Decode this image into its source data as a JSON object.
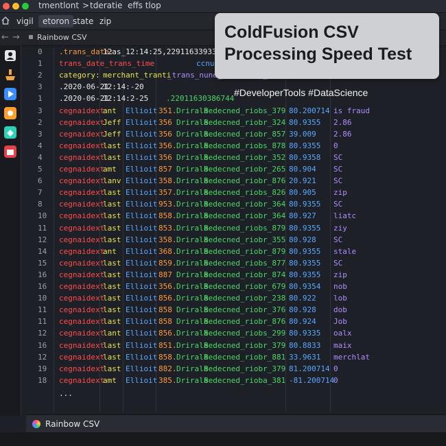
{
  "title_segments": [
    "tmentlont",
    ">",
    "tderatie",
    "effs tlop"
  ],
  "menu": [
    "vigil",
    "etoron",
    "state",
    "zip"
  ],
  "active_menu_index": 1,
  "file_tab": "Rainbow CSV",
  "overlay": {
    "title": "ColdFusion CSV Processing Speed Test",
    "hashtags": "#DeveloperTools #DataScience"
  },
  "colors": {
    "red": "#ff4d4d",
    "orange": "#ff9a3c",
    "yellow": "#e8e24a",
    "green": "#4bd765",
    "blue": "#5aa7ff",
    "purple": "#b18cff",
    "white": "#e8eaee",
    "gray": "#9aa0aa"
  },
  "sidebar_icons": [
    {
      "name": "account-icon",
      "color": "#e6e6e6"
    },
    {
      "name": "debug-icon",
      "color": "#f0a43a"
    },
    {
      "name": "play-icon",
      "color": "#3a8dff"
    },
    {
      "name": "extension-icon",
      "color": "#ff9f2e"
    },
    {
      "name": "tag-icon",
      "color": "#2fd0b8"
    },
    {
      "name": "package-icon",
      "color": "#e2434b"
    }
  ],
  "header_rows": [
    {
      "num": "0",
      "text": ".trans_date:",
      "text2": "12as_12:14:25,22911633933867",
      "color": "orange"
    },
    {
      "num": "1",
      "text": "trans_date_trans_time",
      "text2": "ccnud_Kirlin and Sers_ccnrieu_ ecnl",
      "color": "red"
    },
    {
      "num": "2",
      "text": "category:",
      "text2": "merchant_tranti",
      "text3": "_trans_nune_ merchitt_ rcranations",
      "color": "yellow"
    },
    {
      "num": "3",
      "text": ".2020-06-21",
      "text2": "12:14:-20",
      "color": "white"
    },
    {
      "num": "1",
      "text": ".2020-06-21",
      "text2": "12:14:2-25",
      "text3": ".22011630386744",
      "color": "white"
    }
  ],
  "data_rows": [
    {
      "num": "3",
      "c1": "cegnaidext",
      "c2": "ant",
      "c3": "Ellioit",
      "c4": "351.",
      "c5": "Drirala",
      "c6": "Bedecned_riobs_379",
      "c7": "80.200714",
      "c8": "is fraud"
    },
    {
      "num": "2",
      "c1": "cegnaidext",
      "c2": "Jeff",
      "c3": "Ellioit",
      "c4": "356",
      "c5": "Drirala",
      "c6": "Bedecned_riobr_324",
      "c7": "80.9355",
      "c8": "2.86"
    },
    {
      "num": "3",
      "c1": "cegnaidext",
      "c2": "Jeff",
      "c3": "Ellioit",
      "c4": "356",
      "c5": "Drirala",
      "c6": "Bedecned_riobr_857",
      "c7": "39.009",
      "c8": "2.86"
    },
    {
      "num": "4",
      "c1": "cegnaidext",
      "c2": "last",
      "c3": "Ellioit",
      "c4": "356.",
      "c5": "Drirala",
      "c6": "Bedecned_riobs_878",
      "c7": "80.9355",
      "c8": "0"
    },
    {
      "num": "4",
      "c1": "cegnaidext",
      "c2": "last",
      "c3": "Ellioit",
      "c4": "356",
      "c5": "Drirala",
      "c6": "Bedecned_riobr_352",
      "c7": "80.9358",
      "c8": "SC"
    },
    {
      "num": "5",
      "c1": "cegnaidext",
      "c2": "amt",
      "c3": "Ellioit",
      "c4": "857",
      "c5": "Drirala",
      "c6": "Bedecned_riobr_265",
      "c7": "80.904",
      "c8": "SC"
    },
    {
      "num": "6",
      "c1": "cegnaidext",
      "c2": "lanv",
      "c3": "Ellioit",
      "c4": "358.",
      "c5": "Drirala",
      "c6": "Bedecned_riobr_876",
      "c7": "20.921",
      "c8": "SC"
    },
    {
      "num": "7",
      "c1": "cegnaidext",
      "c2": "last",
      "c3": "Ellioit",
      "c4": "357.",
      "c5": "Drirala",
      "c6": "Bedecned_riobs_826",
      "c7": "80.905",
      "c8": "zip"
    },
    {
      "num": "8",
      "c1": "cegnaidext",
      "c2": "last",
      "c3": "Ellioit",
      "c4": "953.",
      "c5": "Drirala",
      "c6": "Bedecned_riobr_364",
      "c7": "80.9355",
      "c8": "SC"
    },
    {
      "num": "10",
      "c1": "cegnaidext",
      "c2": "last",
      "c3": "Ellioit",
      "c4": "858.",
      "c5": "Drirala",
      "c6": "Bedecned_riobr_364",
      "c7": "80.927",
      "c8": "liatc"
    },
    {
      "num": "11",
      "c1": "cegnaidext",
      "c2": "last",
      "c3": "Ellioit",
      "c4": "853.",
      "c5": "Drirala",
      "c6": "Bedecned_riobs_879",
      "c7": "80.9355",
      "c8": "ziy"
    },
    {
      "num": "12",
      "c1": "cegnaidext",
      "c2": "last",
      "c3": "Ellioit",
      "c4": "358.",
      "c5": "Drirala",
      "c6": "Bedecned_riobr_355",
      "c7": "80.928",
      "c8": "SC"
    },
    {
      "num": "14",
      "c1": "cegnaidext",
      "c2": "ant",
      "c3": "Ellioit",
      "c4": "368.",
      "c5": "Drirala",
      "c6": "Bedecned_riobr_879",
      "c7": "80.9355",
      "c8": "stale"
    },
    {
      "num": "15",
      "c1": "cegnaidext",
      "c2": "last",
      "c3": "Ellioit",
      "c4": "859.",
      "c5": "Drirala",
      "c6": "Bedecned_riobs_877",
      "c7": "80.9355",
      "c8": "SC"
    },
    {
      "num": "16",
      "c1": "cegnaidext",
      "c2": "last",
      "c3": "Ellioit",
      "c4": "887",
      "c5": "Drirala",
      "c6": "Bedecned_riobr_874",
      "c7": "80.9355",
      "c8": "zip"
    },
    {
      "num": "16",
      "c1": "cegnaidext",
      "c2": "last",
      "c3": "Ellioit",
      "c4": "356.",
      "c5": "Drirala",
      "c6": "Bedecned_riobr_679",
      "c7": "80.9354",
      "c8": "nob"
    },
    {
      "num": "10",
      "c1": "cegnaidext",
      "c2": "last",
      "c3": "Ellioit",
      "c4": "856.",
      "c5": "Drirala",
      "c6": "Bedecned_riobr_238",
      "c7": "80.922",
      "c8": "lob"
    },
    {
      "num": "11",
      "c1": "cegnaidext",
      "c2": "last",
      "c3": "Ellioit",
      "c4": "858",
      "c5": "Drirala",
      "c6": "Bedecned_riobr_376",
      "c7": "80.928",
      "c8": "dob"
    },
    {
      "num": "11",
      "c1": "cegnaidext",
      "c2": "last",
      "c3": "Ellioit",
      "c4": "858",
      "c5": "Drirala",
      "c6": "Bedecned_riobr_876",
      "c7": "80.924",
      "c8": "Job"
    },
    {
      "num": "12",
      "c1": "cegnaidext",
      "c2": "lant",
      "c3": "Ellioit",
      "c4": "856.",
      "c5": "Drirala",
      "c6": "Bedecned_riobs_299",
      "c7": "80.9335",
      "c8": "oalx"
    },
    {
      "num": "16",
      "c1": "cegnaidext",
      "c2": "last",
      "c3": "Ellioit",
      "c4": "851.",
      "c5": "Drirala",
      "c6": "Bedecned_riobr_379",
      "c7": "80.8833",
      "c8": "maix"
    },
    {
      "num": "12",
      "c1": "cegnaidext",
      "c2": "last",
      "c3": "Ellioit",
      "c4": "858.",
      "c5": "Drirala",
      "c6": "Bedecned_riobr_881",
      "c7": "33.9631",
      "c8": "merchlat"
    },
    {
      "num": "19",
      "c1": "cegnaidext",
      "c2": "last",
      "c3": "Ellioit",
      "c4": "882.",
      "c5": "Drirala",
      "c6": "Bedecned_riobr_379",
      "c7": "81.200714",
      "c8": "0"
    },
    {
      "num": "18",
      "c1": "cegnaidext",
      "c2": "amt",
      "c3": "Ellioit",
      "c4": "385.",
      "c5": "Drirala",
      "c6": "Bedecned_rioba_381",
      "c7": "-81.200714",
      "c8": "0"
    }
  ],
  "ellipsis": "...",
  "column_colors": [
    "red",
    "yellow",
    "blue",
    "orange",
    "green",
    "green",
    "blue",
    "purple"
  ],
  "status": {
    "label": "Rainbow CSV"
  }
}
